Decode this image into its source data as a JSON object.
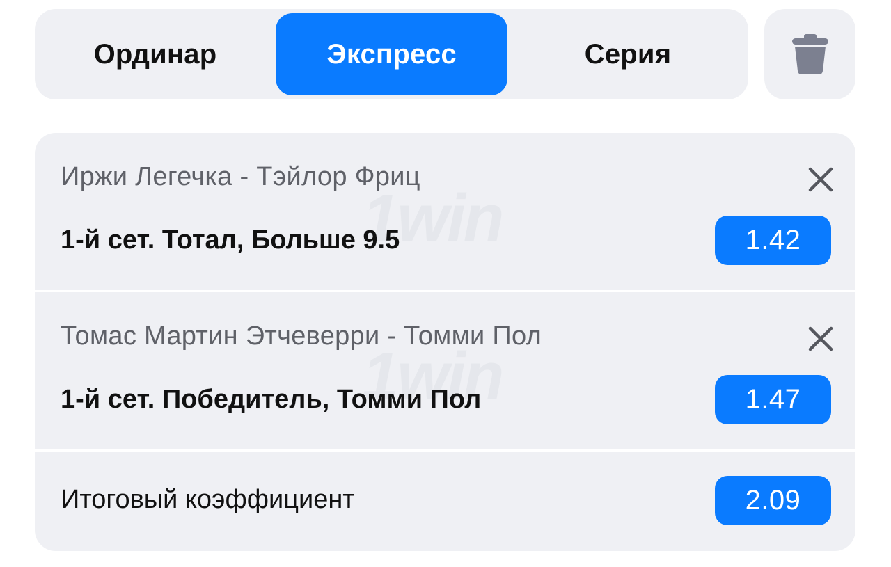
{
  "tabs": [
    {
      "label": "Ординар",
      "active": false
    },
    {
      "label": "Экспресс",
      "active": true
    },
    {
      "label": "Серия",
      "active": false
    }
  ],
  "icons": {
    "trash": "trash-icon",
    "close": "close-icon"
  },
  "watermark": "1win",
  "bets": [
    {
      "match": "Иржи Легечка - Тэйлор Фриц",
      "market": "1-й сет. Тотал, Больше 9.5",
      "odds": "1.42"
    },
    {
      "match": "Томас Мартин Этчеверри - Томми Пол",
      "market": "1-й сет. Победитель, Томми Пол",
      "odds": "1.47"
    }
  ],
  "total": {
    "label": "Итоговый коэффициент",
    "odds": "2.09"
  },
  "colors": {
    "accent": "#0a7bff",
    "panel": "#eff0f4",
    "muted_text": "#5f6168",
    "icon": "#7c8090"
  }
}
